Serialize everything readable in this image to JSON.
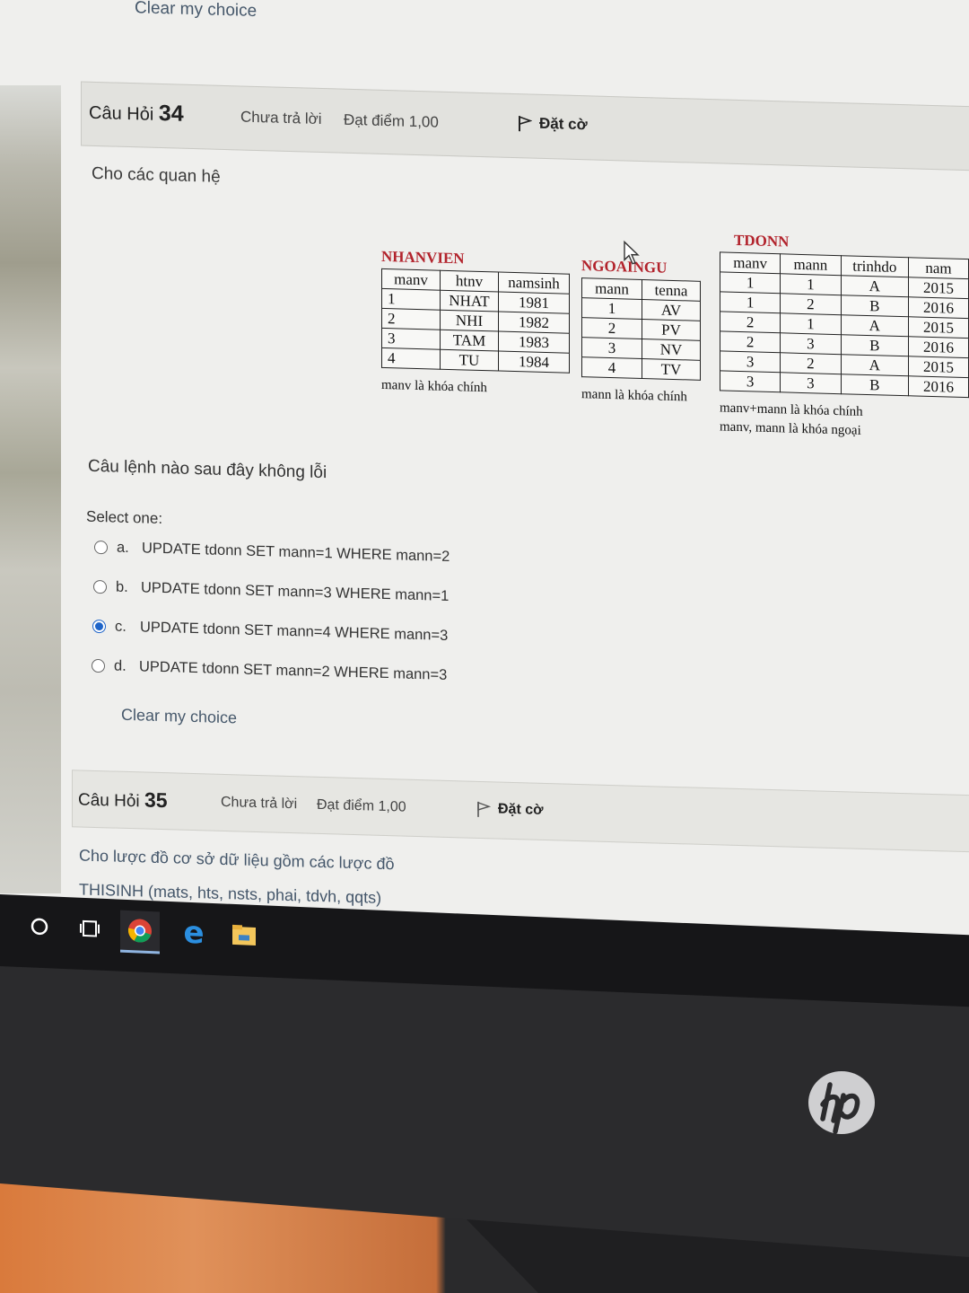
{
  "top_clear_choice": "Clear my choice",
  "question34": {
    "label": "Câu Hỏi",
    "number": "34",
    "state": "Chưa trả lời",
    "grade": "Đạt điểm 1,00",
    "flag_label": "Đặt cờ",
    "intro": "Cho các quan hệ",
    "prompt": "Câu lệnh nào sau đây không lỗi",
    "select_one": "Select one:",
    "options": [
      {
        "letter": "a.",
        "text": "UPDATE tdonn SET mann=1 WHERE mann=2",
        "checked": false
      },
      {
        "letter": "b.",
        "text": "UPDATE tdonn SET mann=3 WHERE mann=1",
        "checked": false
      },
      {
        "letter": "c.",
        "text": "UPDATE tdonn SET mann=4 WHERE mann=3",
        "checked": true
      },
      {
        "letter": "d.",
        "text": "UPDATE tdonn SET mann=2 WHERE mann=3",
        "checked": false
      }
    ],
    "clear_choice": "Clear my choice"
  },
  "relations": {
    "nhanvien": {
      "name": "NHANVIEN",
      "headers": [
        "manv",
        "htnv",
        "namsinh"
      ],
      "rows": [
        [
          "1",
          "NHAT",
          "1981"
        ],
        [
          "2",
          "NHI",
          "1982"
        ],
        [
          "3",
          "TAM",
          "1983"
        ],
        [
          "4",
          "TU",
          "1984"
        ]
      ],
      "note": "manv là khóa chính"
    },
    "ngoaingu": {
      "name": "NGOAINGU",
      "headers": [
        "mann",
        "tenna"
      ],
      "rows": [
        [
          "1",
          "AV"
        ],
        [
          "2",
          "PV"
        ],
        [
          "3",
          "NV"
        ],
        [
          "4",
          "TV"
        ]
      ],
      "note": "mann là khóa chính"
    },
    "tdonn": {
      "name": "TDONN",
      "headers": [
        "manv",
        "mann",
        "trinhdo",
        "nam"
      ],
      "rows": [
        [
          "1",
          "1",
          "A",
          "2015"
        ],
        [
          "1",
          "2",
          "B",
          "2016"
        ],
        [
          "2",
          "1",
          "A",
          "2015"
        ],
        [
          "2",
          "3",
          "B",
          "2016"
        ],
        [
          "3",
          "2",
          "A",
          "2015"
        ],
        [
          "3",
          "3",
          "B",
          "2016"
        ]
      ],
      "note1": "manv+mann là khóa chính",
      "note2": "manv, mann là khóa ngoại"
    }
  },
  "question35": {
    "label": "Câu Hỏi",
    "number": "35",
    "state": "Chưa trả lời",
    "grade": "Đạt điểm 1,00",
    "flag_label": "Đặt cờ",
    "text1": "Cho lược đồ cơ sở dữ liệu gồm các lược đồ",
    "text2": "THISINH (mats, hts, nsts, phai, tdvh, qqts)"
  },
  "taskbar": {
    "icons": [
      "cortana-icon",
      "task-view-icon",
      "chrome-icon",
      "edge-icon",
      "file-explorer-icon"
    ]
  },
  "colors": {
    "relation_name": "#b2232c",
    "radio_checked": "#1e64c8",
    "link": "#46586b"
  }
}
